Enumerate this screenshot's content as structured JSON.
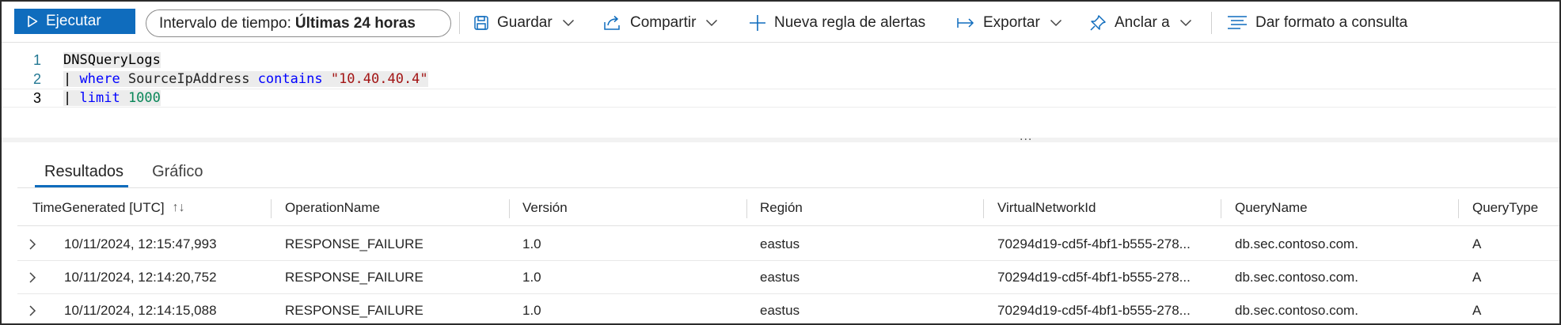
{
  "toolbar": {
    "run_label": "Ejecutar",
    "time_range_label": "Intervalo de tiempo:",
    "time_range_value": "Últimas 24 horas",
    "save_label": "Guardar",
    "share_label": "Compartir",
    "new_alert_label": "Nueva regla de alertas",
    "export_label": "Exportar",
    "pin_label": "Anclar a",
    "format_label": "Dar formato a consulta"
  },
  "editor": {
    "lines": [
      {
        "num": "1",
        "table": "DNSQueryLogs"
      },
      {
        "num": "2",
        "pipe": "|",
        "kw": "where",
        "field": " SourceIpAddress ",
        "op": "contains",
        "str": "\"10.40.40.4\""
      },
      {
        "num": "3",
        "pipe": "|",
        "kw": "limit",
        "num_val": "1000"
      }
    ],
    "splitter_label": "..."
  },
  "tabs": [
    {
      "label": "Resultados",
      "active": true
    },
    {
      "label": "Gráfico",
      "active": false
    }
  ],
  "table": {
    "columns": [
      "TimeGenerated [UTC]",
      "OperationName",
      "Versión",
      "Región",
      "VirtualNetworkId",
      "QueryName",
      "QueryType"
    ],
    "sort_icon": "↑↓",
    "rows": [
      [
        "10/11/2024, 12:15:47,993",
        "RESPONSE_FAILURE",
        "1.0",
        "eastus",
        "70294d19-cd5f-4bf1-b555-278...",
        "db.sec.contoso.com.",
        "A"
      ],
      [
        "10/11/2024, 12:14:20,752",
        "RESPONSE_FAILURE",
        "1.0",
        "eastus",
        "70294d19-cd5f-4bf1-b555-278...",
        "db.sec.contoso.com.",
        "A"
      ],
      [
        "10/11/2024, 12:14:15,088",
        "RESPONSE_FAILURE",
        "1.0",
        "eastus",
        "70294d19-cd5f-4bf1-b555-278...",
        "db.sec.contoso.com.",
        "A"
      ]
    ]
  },
  "colors": {
    "accent": "#0f6cbd",
    "keyword": "#0000ff",
    "string": "#a31515",
    "number": "#098658",
    "line_number": "#237893"
  },
  "icons": {
    "run": "play-icon",
    "save": "save-icon",
    "share": "share-icon",
    "new_alert": "plus-icon",
    "export": "export-arrow-icon",
    "pin": "pin-icon",
    "format": "format-lines-icon",
    "dropdown": "chevron-down-icon",
    "expander": "chevron-right-icon"
  }
}
